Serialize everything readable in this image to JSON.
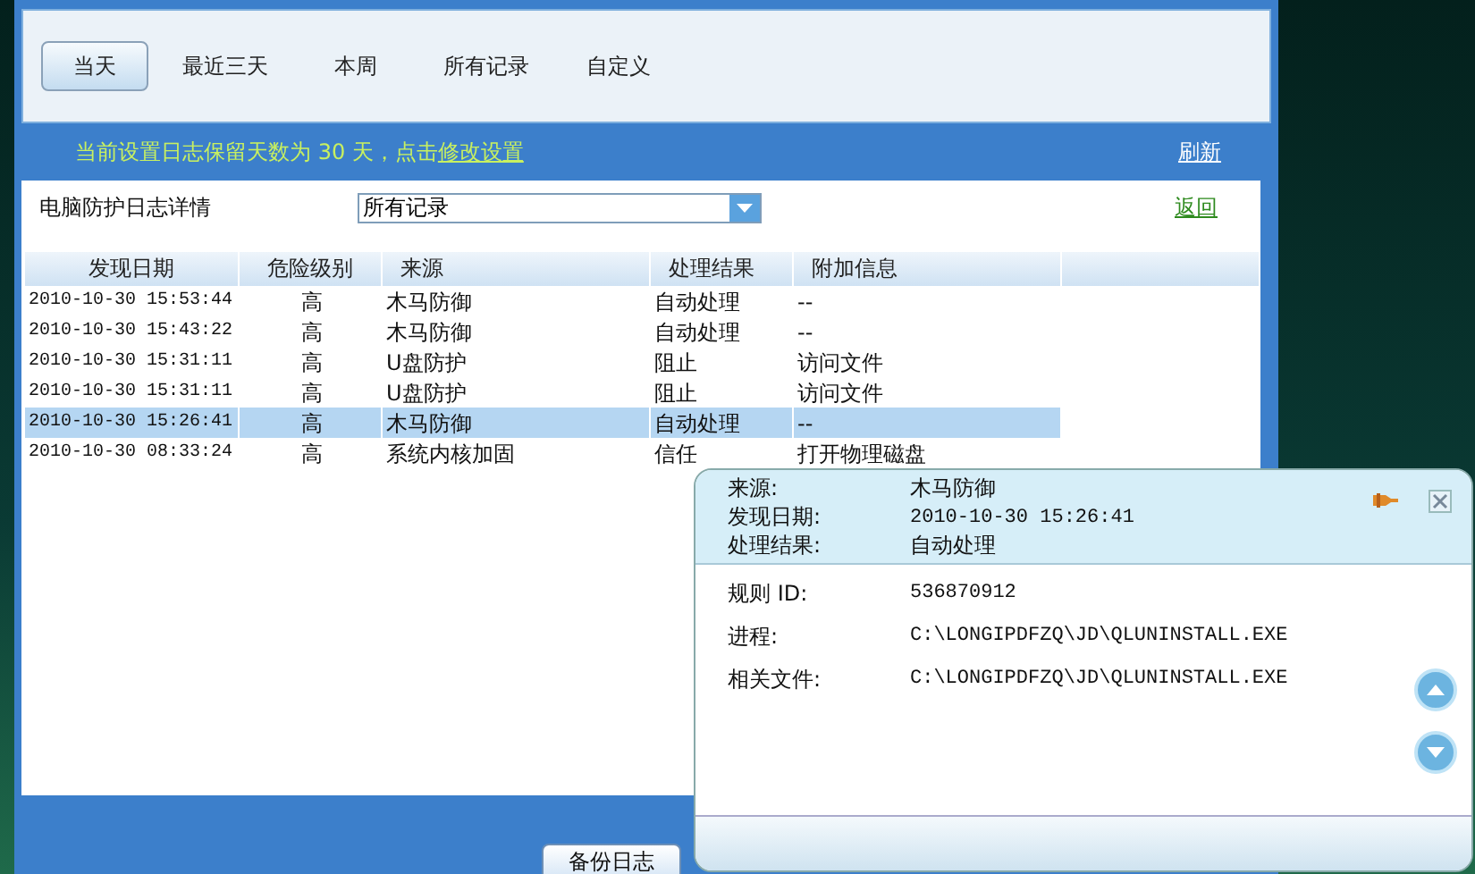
{
  "tabs": [
    {
      "label": "当天",
      "selected": true
    },
    {
      "label": "最近三天",
      "selected": false
    },
    {
      "label": "本周",
      "selected": false
    },
    {
      "label": "所有记录",
      "selected": false
    },
    {
      "label": "自定义",
      "selected": false
    }
  ],
  "notice": {
    "text": "当前设置日志保留天数为 30 天，点击",
    "link": "修改设置"
  },
  "refresh_link": "刷新",
  "filter": {
    "label": "电脑防护日志详情",
    "value": "所有记录"
  },
  "back_link": "返回",
  "table": {
    "columns": [
      "发现日期",
      "危险级别",
      "来源",
      "处理结果",
      "附加信息"
    ],
    "rows": [
      {
        "cells": [
          "2010-10-30 15:53:44",
          "高",
          "木马防御",
          "自动处理",
          "--"
        ],
        "selected": false
      },
      {
        "cells": [
          "2010-10-30 15:43:22",
          "高",
          "木马防御",
          "自动处理",
          "--"
        ],
        "selected": false
      },
      {
        "cells": [
          "2010-10-30 15:31:11",
          "高",
          "U盘防护",
          "阻止",
          "访问文件"
        ],
        "selected": false
      },
      {
        "cells": [
          "2010-10-30 15:31:11",
          "高",
          "U盘防护",
          "阻止",
          "访问文件"
        ],
        "selected": false
      },
      {
        "cells": [
          "2010-10-30 15:26:41",
          "高",
          "木马防御",
          "自动处理",
          "--"
        ],
        "selected": true
      },
      {
        "cells": [
          "2010-10-30 08:33:24",
          "高",
          "系统内核加固",
          "信任",
          "打开物理磁盘"
        ],
        "selected": false
      }
    ]
  },
  "bottom_button": "备份日志",
  "popup": {
    "summary": [
      {
        "label": "来源:",
        "value": "木马防御"
      },
      {
        "label": "发现日期:",
        "value": "2010-10-30 15:26:41"
      },
      {
        "label": "处理结果:",
        "value": "自动处理"
      }
    ],
    "details": [
      {
        "label": "规则 ID:",
        "value": "536870912"
      },
      {
        "label": "进程:",
        "value": "C:\\LONGIPDFZQ\\JD\\QLUNINSTALL.EXE"
      },
      {
        "label": "相关文件:",
        "value": "C:\\LONGIPDFZQ\\JD\\QLUNINSTALL.EXE"
      }
    ]
  }
}
